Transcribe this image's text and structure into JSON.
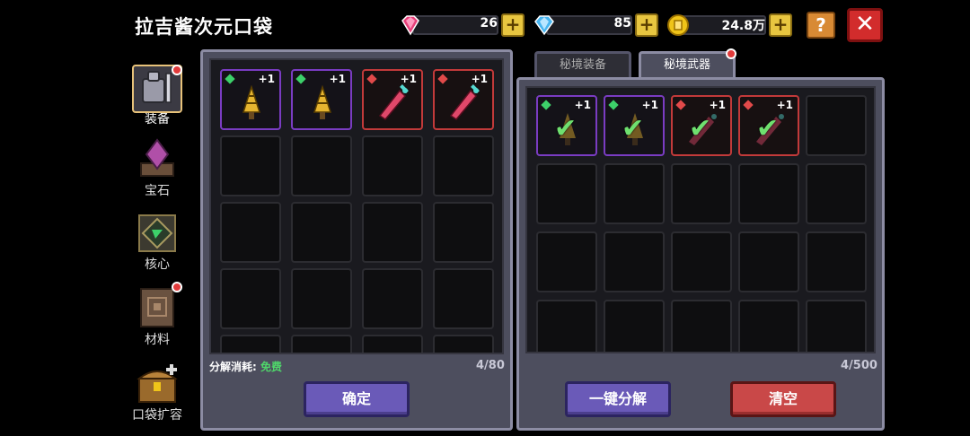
{
  "title": "拉吉酱次元口袋",
  "currency": [
    {
      "name": "pink-gem",
      "value": "26",
      "color": "#e8407a"
    },
    {
      "name": "blue-diamond",
      "value": "85",
      "color": "#47b5f0"
    },
    {
      "name": "gold-coin",
      "value": "24.8万",
      "color": "#f0c419"
    }
  ],
  "buttons": {
    "help": "?",
    "close": "✕",
    "plus": "+"
  },
  "sidebar": [
    {
      "label": "装备",
      "icon": "armor-icon",
      "active": true,
      "dot": true
    },
    {
      "label": "宝石",
      "icon": "gem-icon",
      "active": false,
      "dot": false
    },
    {
      "label": "核心",
      "icon": "core-icon",
      "active": false,
      "dot": false
    },
    {
      "label": "材料",
      "icon": "material-icon",
      "active": false,
      "dot": true
    },
    {
      "label": "口袋扩容",
      "icon": "chest-icon",
      "active": false,
      "dot": false
    }
  ],
  "left_panel": {
    "cost_label": "分解消耗:",
    "cost_value": "免费",
    "count": "4/80",
    "confirm": "确定",
    "items": [
      {
        "type": "drill",
        "rarity": "purple",
        "level": "+1",
        "gem": "#3dd06a"
      },
      {
        "type": "drill",
        "rarity": "purple",
        "level": "+1",
        "gem": "#3dd06a"
      },
      {
        "type": "sword",
        "rarity": "red",
        "level": "+1",
        "gem": "#e14a4a"
      },
      {
        "type": "sword",
        "rarity": "red",
        "level": "+1",
        "gem": "#e14a4a"
      }
    ]
  },
  "right_panel": {
    "tabs": [
      {
        "label": "秘境装备",
        "active": false
      },
      {
        "label": "秘境武器",
        "active": true
      }
    ],
    "count": "4/500",
    "decompose": "一键分解",
    "clear": "清空",
    "items": [
      {
        "type": "drill",
        "rarity": "purple",
        "level": "+1",
        "gem": "#3dd06a",
        "selected": true
      },
      {
        "type": "drill",
        "rarity": "purple",
        "level": "+1",
        "gem": "#3dd06a",
        "selected": true
      },
      {
        "type": "sword",
        "rarity": "red",
        "level": "+1",
        "gem": "#e14a4a",
        "selected": true
      },
      {
        "type": "sword",
        "rarity": "red",
        "level": "+1",
        "gem": "#e14a4a",
        "selected": true
      }
    ]
  }
}
